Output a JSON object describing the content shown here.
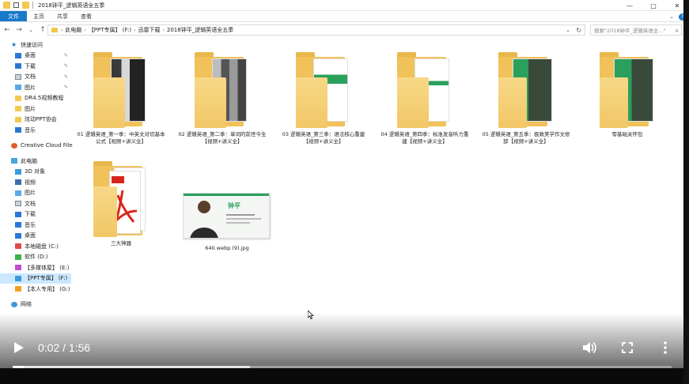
{
  "window": {
    "title": "2018钟平_逻辑英语全五季",
    "controls": [
      "—",
      "□",
      "✕"
    ]
  },
  "ribbon": {
    "tabs": [
      "文件",
      "主页",
      "共享",
      "查看"
    ]
  },
  "address": {
    "crumbs": [
      "此电脑",
      "【PPT专属】 (F:)",
      "迅雷下载",
      "2018钟平_逻辑英语全五季"
    ],
    "search_placeholder": "搜索\"2018钟平_逻辑英语全...\""
  },
  "nav": {
    "quick_access": "快速访问",
    "quick_items": [
      "桌面",
      "下载",
      "文档",
      "图片",
      "DR4.5视频教程",
      "图片",
      "炫动PPT协会",
      "音乐"
    ],
    "cloud": "Creative Cloud Files",
    "this_pc": "此电脑",
    "pc_items": [
      "3D 对象",
      "视频",
      "图片",
      "文档",
      "下载",
      "音乐",
      "桌面"
    ],
    "drives": [
      "本地磁盘 (C:)",
      "软件 (D:)",
      "【多媒体屋】 (E:)",
      "【PPT专属】 (F:)",
      "【本人专用】 (G:)"
    ],
    "network": "网络"
  },
  "files": [
    {
      "label": "01 逻辑英语_第一季：中英文对切基本公式【视频+讲义全】",
      "kind": "folder-photo"
    },
    {
      "label": "02 逻辑英语_第二季：单词的前世今生【视频+讲义全】",
      "kind": "folder-photo"
    },
    {
      "label": "03 逻辑英语_第三季：语法核心重建【视频+讲义全】",
      "kind": "folder-green"
    },
    {
      "label": "04 逻辑英语_第四季：标准发音听力重建【视频+讲义全】",
      "kind": "folder-white"
    },
    {
      "label": "05 逻辑英语_第五季：极致美学作文修辞【视频+讲义全】",
      "kind": "folder-green"
    },
    {
      "label": "零基础关怀包",
      "kind": "folder-green"
    },
    {
      "label": "三大神器",
      "kind": "folder-pdf"
    },
    {
      "label": "640.webp (9).jpg",
      "kind": "image",
      "thumb_name": "钟平"
    }
  ],
  "player": {
    "time": "0:02 / 1:56",
    "played_fraction": 0.017,
    "buffered_fraction": 0.36
  }
}
